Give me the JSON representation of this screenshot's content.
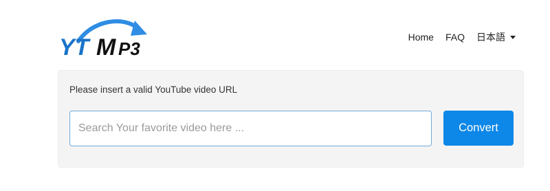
{
  "logo": {
    "text_yt": "YT",
    "text_m": "M",
    "text_p3": "P3",
    "colors": {
      "blue": "#1a73c9",
      "dark": "#111111",
      "arrow": "#2f8de4"
    }
  },
  "nav": {
    "home_label": "Home",
    "faq_label": "FAQ",
    "language_label": "日本語"
  },
  "converter": {
    "instruction": "Please insert a valid YouTube video URL",
    "input_value": "",
    "input_placeholder": "Search Your favorite video here ...",
    "button_label": "Convert",
    "button_color": "#0d87e8"
  }
}
